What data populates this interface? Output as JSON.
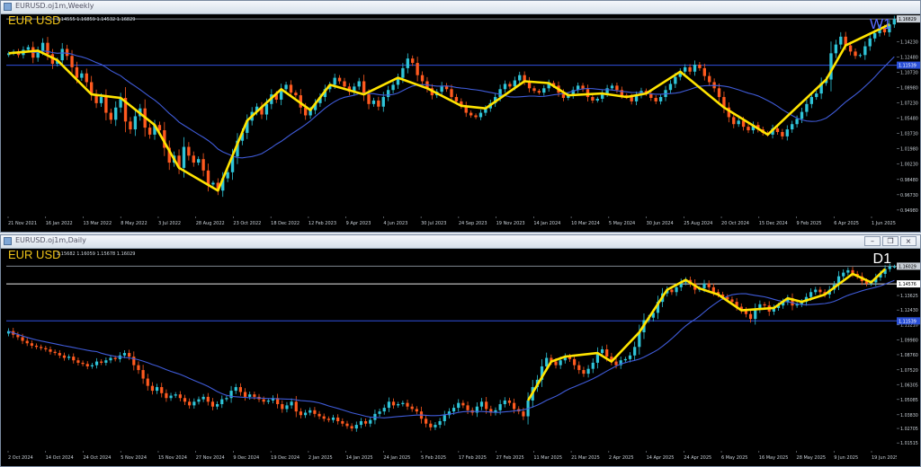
{
  "chart_data": [
    {
      "type": "candlestick",
      "window_title": "EURUSD.oj1m,Weekly",
      "symbol_label": "EUR USD",
      "timeframe_label": "W1",
      "ohlc_label": "1.14555 1.16859 1.14532 1.16829",
      "yaxis_ticks": [
        "1.14230",
        "1.12480",
        "1.10730",
        "1.08980",
        "1.07230",
        "1.05480",
        "1.03730",
        "1.01980",
        "1.00230",
        "0.98480",
        "0.96730",
        "0.94980"
      ],
      "ylim": [
        0.9435,
        1.1735
      ],
      "xaxis_ticks": [
        "21 Nov 2021",
        "16 Jan 2022",
        "13 Mar 2022",
        "8 May 2022",
        "3 Jul 2022",
        "28 Aug 2022",
        "23 Oct 2022",
        "18 Dec 2022",
        "12 Feb 2023",
        "9 Apr 2023",
        "4 Jun 2023",
        "30 Jul 2023",
        "24 Sep 2023",
        "19 Nov 2023",
        "14 Jan 2024",
        "10 Mar 2024",
        "5 May 2024",
        "30 Jun 2024",
        "25 Aug 2024",
        "20 Oct 2024",
        "15 Dec 2024",
        "9 Feb 2025",
        "6 Apr 2025",
        "1 Jun 2025"
      ],
      "price_tags": [
        {
          "value": "1.16829",
          "y": 1.16829,
          "color": "#c7cdd4",
          "text": "#000"
        },
        {
          "value": "1.11539",
          "y": 1.1154,
          "color": "#2a4fd6",
          "text": "#fff"
        }
      ],
      "hlines": [
        {
          "y": 1.16829,
          "color": "#808890"
        },
        {
          "y": 1.1154,
          "color": "#3050e0"
        }
      ],
      "n_bars": 188,
      "close": [
        1.129,
        1.131,
        1.127,
        1.133,
        1.136,
        1.124,
        1.132,
        1.141,
        1.128,
        1.117,
        1.121,
        1.134,
        1.126,
        1.113,
        1.101,
        1.106,
        1.096,
        1.082,
        1.072,
        1.079,
        1.061,
        1.053,
        1.067,
        1.078,
        1.051,
        1.042,
        1.057,
        1.066,
        1.044,
        1.036,
        1.047,
        1.041,
        1.021,
        1.004,
        1.012,
        0.998,
        1.022,
        1.012,
        1.004,
        1.008,
        0.995,
        0.979,
        0.981,
        0.972,
        0.986,
        0.993,
        1.011,
        1.029,
        1.038,
        1.052,
        1.062,
        1.068,
        1.059,
        1.071,
        1.082,
        1.076,
        1.088,
        1.093,
        1.084,
        1.081,
        1.067,
        1.058,
        1.064,
        1.072,
        1.079,
        1.088,
        1.093,
        1.101,
        1.097,
        1.091,
        1.085,
        1.091,
        1.097,
        1.082,
        1.071,
        1.075,
        1.068,
        1.079,
        1.087,
        1.093,
        1.101,
        1.112,
        1.123,
        1.118,
        1.104,
        1.097,
        1.089,
        1.081,
        1.085,
        1.092,
        1.088,
        1.079,
        1.074,
        1.069,
        1.061,
        1.058,
        1.056,
        1.061,
        1.066,
        1.072,
        1.079,
        1.088,
        1.094,
        1.091,
        1.098,
        1.104,
        1.097,
        1.089,
        1.086,
        1.084,
        1.089,
        1.095,
        1.092,
        1.084,
        1.078,
        1.081,
        1.087,
        1.092,
        1.088,
        1.079,
        1.075,
        1.077,
        1.083,
        1.089,
        1.092,
        1.087,
        1.081,
        1.079,
        1.074,
        1.081,
        1.086,
        1.083,
        1.078,
        1.074,
        1.079,
        1.087,
        1.094,
        1.102,
        1.108,
        1.113,
        1.108,
        1.116,
        1.112,
        1.103,
        1.096,
        1.089,
        1.079,
        1.067,
        1.056,
        1.048,
        1.052,
        1.045,
        1.041,
        1.047,
        1.042,
        1.038,
        1.036,
        1.043,
        1.039,
        1.034,
        1.042,
        1.048,
        1.054,
        1.062,
        1.071,
        1.079,
        1.083,
        1.095,
        1.099,
        1.129,
        1.139,
        1.148,
        1.138,
        1.131,
        1.126,
        1.127,
        1.137,
        1.146,
        1.152,
        1.158,
        1.153,
        1.162,
        1.168
      ],
      "zigzag_close_indices": [
        0,
        6,
        10,
        17,
        23,
        30,
        35,
        43,
        49,
        56,
        62,
        66,
        73,
        80,
        86,
        93,
        98,
        106,
        111,
        115,
        122,
        127,
        131,
        138,
        147,
        156,
        168,
        172,
        181,
        185,
        187
      ]
    },
    {
      "type": "candlestick",
      "window_title": "EURUSD.oj1m,Daily",
      "symbol_label": "EUR USD",
      "timeframe_label": "D1",
      "ohlc_label": "1.15682 1.16059 1.15678 1.16029",
      "yaxis_ticks": [
        "1.13625",
        "1.12430",
        "1.11210",
        "1.09980",
        "1.08760",
        "1.07520",
        "1.06305",
        "1.05085",
        "1.03830",
        "1.02705",
        "1.01515"
      ],
      "ylim": [
        1.0094,
        1.1746
      ],
      "xaxis_ticks": [
        "2 Oct 2024",
        "14 Oct 2024",
        "24 Oct 2024",
        "5 Nov 2024",
        "15 Nov 2024",
        "27 Nov 2024",
        "9 Dec 2024",
        "19 Dec 2024",
        "2 Jan 2025",
        "14 Jan 2025",
        "24 Jan 2025",
        "5 Feb 2025",
        "17 Feb 2025",
        "27 Feb 2025",
        "11 Mar 2025",
        "21 Mar 2025",
        "2 Apr 2025",
        "14 Apr 2025",
        "24 Apr 2025",
        "6 May 2025",
        "16 May 2025",
        "28 May 2025",
        "9 Jun 2025",
        "19 Jun 2025"
      ],
      "price_tags": [
        {
          "value": "1.16029",
          "y": 1.16029,
          "color": "#c7cdd4",
          "text": "#000"
        },
        {
          "value": "1.14576",
          "y": 1.14576,
          "color": "#ffffff",
          "text": "#000"
        },
        {
          "value": "1.11539",
          "y": 1.1154,
          "color": "#2a4fd6",
          "text": "#fff"
        }
      ],
      "hlines": [
        {
          "y": 1.16029,
          "color": "#808890"
        },
        {
          "y": 1.14576,
          "color": "#e8e8e8"
        },
        {
          "y": 1.1154,
          "color": "#3050e0"
        }
      ],
      "n_bars": 190,
      "close": [
        1.107,
        1.104,
        1.102,
        1.099,
        1.097,
        1.095,
        1.094,
        1.093,
        1.092,
        1.09,
        1.089,
        1.087,
        1.085,
        1.086,
        1.083,
        1.081,
        1.08,
        1.078,
        1.079,
        1.082,
        1.081,
        1.083,
        1.085,
        1.084,
        1.087,
        1.089,
        1.086,
        1.079,
        1.075,
        1.068,
        1.062,
        1.058,
        1.061,
        1.056,
        1.052,
        1.054,
        1.055,
        1.052,
        1.049,
        1.046,
        1.049,
        1.051,
        1.053,
        1.049,
        1.045,
        1.047,
        1.051,
        1.052,
        1.058,
        1.061,
        1.057,
        1.053,
        1.055,
        1.053,
        1.051,
        1.049,
        1.05,
        1.052,
        1.047,
        1.043,
        1.046,
        1.049,
        1.041,
        1.038,
        1.04,
        1.042,
        1.039,
        1.037,
        1.035,
        1.034,
        1.036,
        1.033,
        1.031,
        1.029,
        1.027,
        1.03,
        1.033,
        1.031,
        1.034,
        1.039,
        1.041,
        1.044,
        1.049,
        1.046,
        1.047,
        1.048,
        1.045,
        1.043,
        1.041,
        1.035,
        1.031,
        1.028,
        1.03,
        1.033,
        1.038,
        1.041,
        1.044,
        1.048,
        1.046,
        1.042,
        1.04,
        1.045,
        1.049,
        1.043,
        1.04,
        1.042,
        1.047,
        1.05,
        1.048,
        1.043,
        1.041,
        1.037,
        1.05,
        1.061,
        1.067,
        1.078,
        1.085,
        1.082,
        1.079,
        1.083,
        1.086,
        1.084,
        1.079,
        1.075,
        1.072,
        1.076,
        1.081,
        1.089,
        1.092,
        1.086,
        1.082,
        1.079,
        1.083,
        1.084,
        1.087,
        1.094,
        1.106,
        1.116,
        1.118,
        1.122,
        1.131,
        1.138,
        1.141,
        1.139,
        1.143,
        1.147,
        1.149,
        1.146,
        1.141,
        1.142,
        1.146,
        1.143,
        1.139,
        1.137,
        1.135,
        1.133,
        1.131,
        1.127,
        1.124,
        1.121,
        1.117,
        1.125,
        1.129,
        1.128,
        1.123,
        1.126,
        1.128,
        1.131,
        1.134,
        1.128,
        1.129,
        1.131,
        1.135,
        1.139,
        1.141,
        1.139,
        1.137,
        1.141,
        1.145,
        1.152,
        1.155,
        1.157,
        1.154,
        1.152,
        1.148,
        1.146,
        1.147,
        1.151,
        1.154,
        1.158,
        1.16,
        1.16
      ],
      "zigzag_close_indices": [
        112,
        117,
        120,
        127,
        130,
        136,
        142,
        146,
        149,
        153,
        158,
        165,
        168,
        171,
        176,
        182,
        186,
        189
      ]
    }
  ]
}
